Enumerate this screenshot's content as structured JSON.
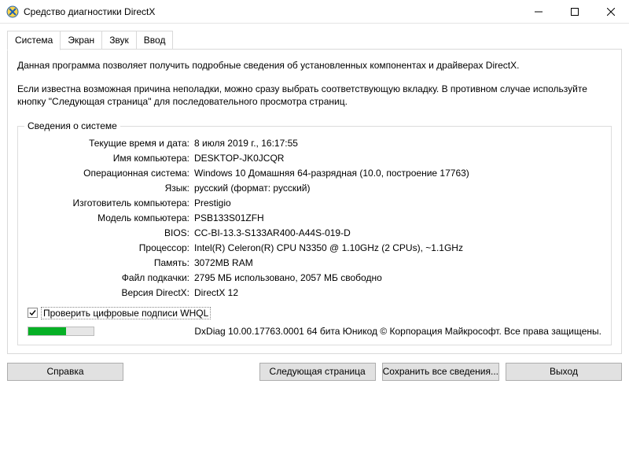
{
  "titlebar": {
    "title": "Средство диагностики DirectX"
  },
  "tabs": {
    "system": "Система",
    "screen": "Экран",
    "sound": "Звук",
    "input": "Ввод"
  },
  "intro": {
    "p1": "Данная программа позволяет получить подробные сведения об установленных компонентах и драйверах DirectX.",
    "p2": "Если известна возможная причина неполадки, можно сразу выбрать соответствующую вкладку. В противном случае используйте кнопку \"Следующая страница\" для последовательного просмотра страниц."
  },
  "sysinfo": {
    "legend": "Сведения о системе",
    "rows": [
      {
        "label": "Текущие время и дата:",
        "value": "8 июля 2019 г., 16:17:55"
      },
      {
        "label": "Имя компьютера:",
        "value": "DESKTOP-JK0JCQR"
      },
      {
        "label": "Операционная система:",
        "value": "Windows 10 Домашняя 64-разрядная (10.0, построение 17763)"
      },
      {
        "label": "Язык:",
        "value": "русский (формат: русский)"
      },
      {
        "label": "Изготовитель компьютера:",
        "value": "Prestigio"
      },
      {
        "label": "Модель компьютера:",
        "value": "PSB133S01ZFH"
      },
      {
        "label": "BIOS:",
        "value": "CC-BI-13.3-S133AR400-A44S-019-D"
      },
      {
        "label": "Процессор:",
        "value": "Intel(R) Celeron(R) CPU N3350 @ 1.10GHz (2 CPUs), ~1.1GHz"
      },
      {
        "label": "Память:",
        "value": "3072MB RAM"
      },
      {
        "label": "Файл подкачки:",
        "value": "2795 МБ использовано, 2057 МБ свободно"
      },
      {
        "label": "Версия DirectX:",
        "value": "DirectX 12"
      }
    ],
    "whql_label": "Проверить цифровые подписи WHQL"
  },
  "footer": {
    "text": "DxDiag 10.00.17763.0001 64 бита Юникод © Корпорация Майкрософт. Все права защищены."
  },
  "buttons": {
    "help": "Справка",
    "next": "Следующая страница",
    "save": "Сохранить все сведения...",
    "exit": "Выход"
  }
}
